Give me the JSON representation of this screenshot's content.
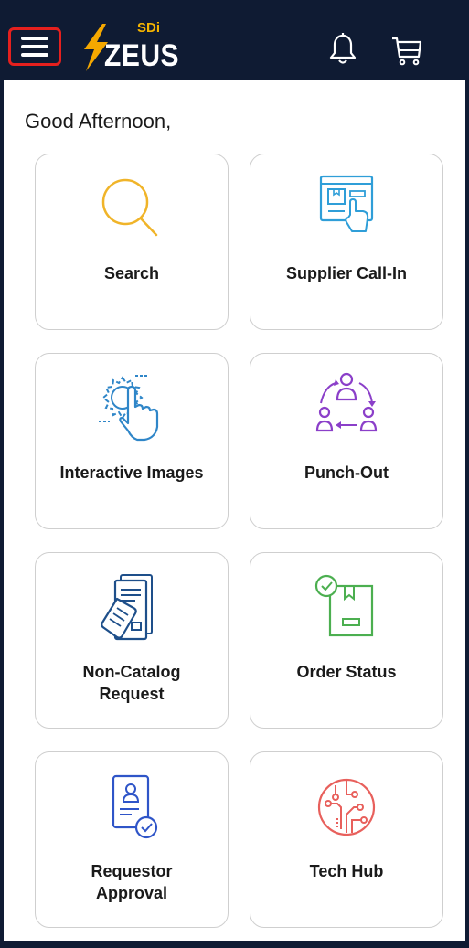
{
  "header": {
    "logo_main": "ZEUS",
    "logo_sub": "SDi",
    "menu_icon": "hamburger-menu-icon",
    "bell_icon": "bell-icon",
    "cart_icon": "cart-icon",
    "menu_highlight_color": "#e5201e",
    "background_color": "#0f1b33"
  },
  "main": {
    "greeting": "Good Afternoon,",
    "tiles": [
      {
        "label": "Search",
        "icon": "search-icon",
        "color": "#f0b429"
      },
      {
        "label": "Supplier Call-In",
        "icon": "supplier-call-in-icon",
        "color": "#2f9ed8"
      },
      {
        "label": "Interactive Images",
        "icon": "interactive-images-icon",
        "color": "#2f86c8"
      },
      {
        "label": "Punch-Out",
        "icon": "punch-out-icon",
        "color": "#8b3fc9"
      },
      {
        "label": "Non-Catalog\nRequest",
        "icon": "non-catalog-request-icon",
        "color": "#1e4f8a"
      },
      {
        "label": "Order Status",
        "icon": "order-status-icon",
        "color": "#4caf50"
      },
      {
        "label": "Requestor\nApproval",
        "icon": "requestor-approval-icon",
        "color": "#2f55c8"
      },
      {
        "label": "Tech Hub",
        "icon": "tech-hub-icon",
        "color": "#e8605c"
      }
    ]
  }
}
